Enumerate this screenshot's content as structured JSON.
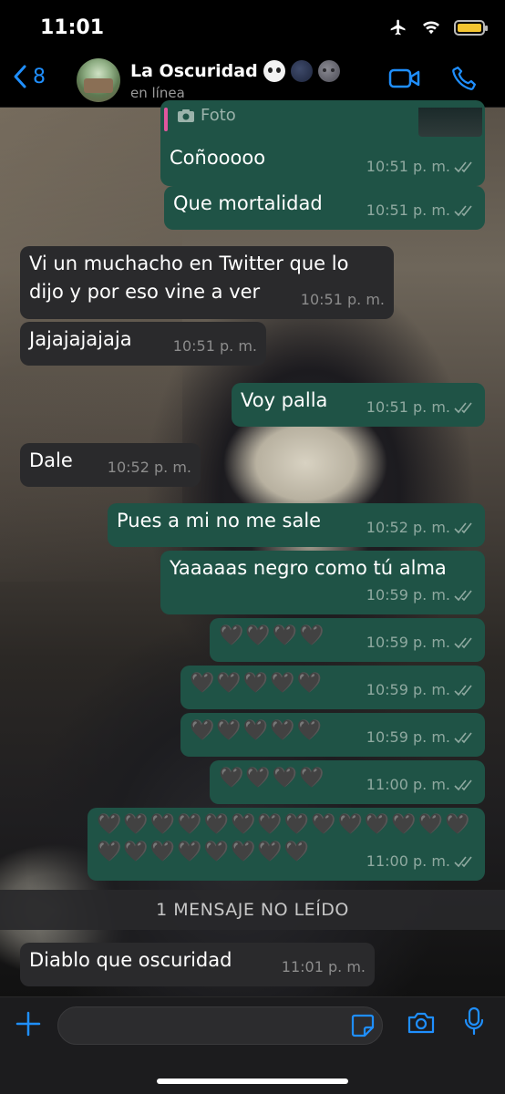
{
  "status_bar": {
    "time": "11:01"
  },
  "header": {
    "back_count": "8",
    "title": "La Oscuridad",
    "status": "en línea"
  },
  "messages": [
    {
      "dir": "out",
      "text": "Coñooooo",
      "time": "10:51 p. m.",
      "reply_caption": "Foto"
    },
    {
      "dir": "out",
      "text": "Que mortalidad",
      "time": "10:51 p. m."
    },
    {
      "dir": "in",
      "text": "Vi un muchacho en Twitter que lo dijo y por eso vine a ver",
      "time": "10:51 p. m."
    },
    {
      "dir": "in",
      "text": "Jajajajajaja",
      "time": "10:51 p. m."
    },
    {
      "dir": "out",
      "text": "Voy palla",
      "time": "10:51 p. m."
    },
    {
      "dir": "in",
      "text": "Dale",
      "time": "10:52 p. m."
    },
    {
      "dir": "out",
      "text": "Pues a mi no me sale",
      "time": "10:52 p. m."
    },
    {
      "dir": "out",
      "text": "Yaaaaas negro como tú alma",
      "time": "10:59 p. m."
    },
    {
      "dir": "out",
      "text": "🖤🖤🖤🖤",
      "time": "10:59 p. m."
    },
    {
      "dir": "out",
      "text": "🖤🖤🖤🖤🖤",
      "time": "10:59 p. m."
    },
    {
      "dir": "out",
      "text": "🖤🖤🖤🖤🖤",
      "time": "10:59 p. m."
    },
    {
      "dir": "out",
      "text": "🖤🖤🖤🖤",
      "time": "11:00 p. m."
    },
    {
      "dir": "out",
      "text": "🖤🖤🖤🖤🖤🖤🖤🖤🖤🖤🖤🖤🖤🖤🖤🖤🖤🖤🖤🖤🖤🖤",
      "time": "11:00 p. m."
    },
    {
      "dir": "in",
      "text": "Diablo que oscuridad",
      "time": "11:01 p. m."
    }
  ],
  "unread_banner": "1 MENSAJE NO LEÍDO",
  "composer": {
    "placeholder": ""
  },
  "colors": {
    "accent": "#1f8fff",
    "outgoing": "#1f5346",
    "incoming": "#2a2a2c"
  }
}
